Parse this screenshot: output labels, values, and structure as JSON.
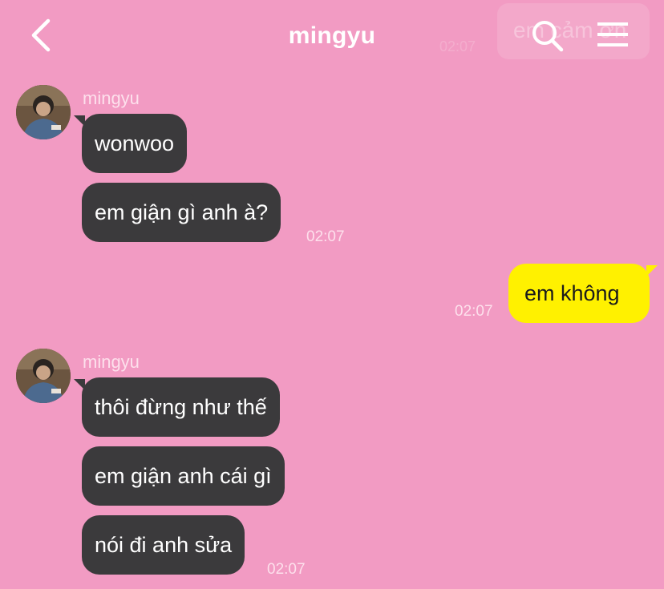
{
  "header": {
    "title": "mingyu",
    "ghost_text": "em cảm ơn",
    "ghost_time": "02:07",
    "back_icon": "chevron-left-icon",
    "search_icon": "search-icon",
    "menu_icon": "hamburger-menu-icon"
  },
  "colors": {
    "background": "#f29bc3",
    "incoming_bubble": "#3b3a3c",
    "outgoing_bubble": "#fff100"
  },
  "messages": {
    "group1": {
      "sender": "mingyu",
      "bubbles": [
        "wonwoo",
        "em giận gì anh à?"
      ],
      "time": "02:07"
    },
    "mine": {
      "text": "em không",
      "time": "02:07"
    },
    "group2": {
      "sender": "mingyu",
      "bubbles": [
        "thôi đừng như thế",
        "em giận anh cái gì",
        "nói đi anh sửa"
      ],
      "time": "02:07"
    }
  }
}
